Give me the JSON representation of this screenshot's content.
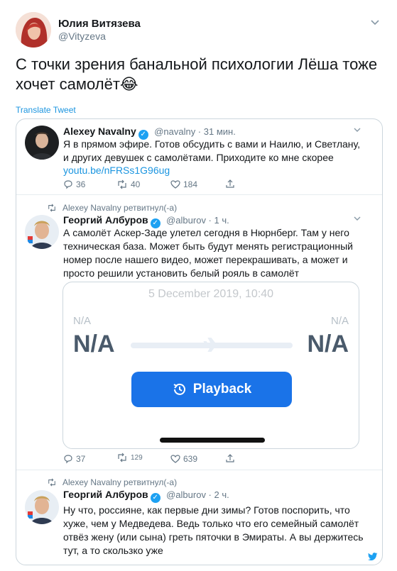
{
  "main_tweet": {
    "author_name": "Юлия Витязева",
    "author_handle": "@Vityzeva",
    "text": "С точки зрения банальной психологии Лёша тоже хочет самолёт😂",
    "translate_label": "Translate Tweet"
  },
  "quoted": [
    {
      "retweet_label": "",
      "name": "Alexey Navalny",
      "handle_time": "@navalny · 31 мин.",
      "text": "Я в прямом эфире. Готов обсудить с вами и Наилю, и Светлану, и других девушек с самолётами. Приходите ко мне скорее",
      "link": "youtu.be/nFRSs1G96ug",
      "replies": "36",
      "retweets": "40",
      "likes": "184"
    },
    {
      "retweet_label": "Alexey Navalny ретвитнул(-а)",
      "name": "Георгий Албуров",
      "handle_time": "@alburov · 1 ч.",
      "text": "А самолёт Аскер-Заде улетел сегодня в Нюрнберг. Там у него техническая база. Может быть будут менять регистрационный номер после нашего видео, может перекрашивать, а может и просто решили установить белый рояль в самолёт",
      "replies": "37",
      "retweets": "129",
      "likes": "639"
    },
    {
      "retweet_label": "Alexey Navalny ретвитнул(-а)",
      "name": "Георгий Албуров",
      "handle_time": "@alburov · 2 ч.",
      "text": "Ну что, россияне, как первые дни зимы? Готов поспорить, что хуже, чем у Медведева. Ведь только что его семейный самолёт отвёз жену (или сына) греть пяточки в Эмираты. А вы держитесь тут, а то скользко уже"
    }
  ],
  "media": {
    "date": "5 December 2019, 10:40",
    "left_small": "N/A",
    "left_big": "N/A",
    "right_small": "N/A",
    "right_big": "N/A",
    "playback_label": "Playback"
  },
  "colors": {
    "accent": "#1da1f2",
    "link": "#1b95e0",
    "playback": "#1a73e8"
  }
}
